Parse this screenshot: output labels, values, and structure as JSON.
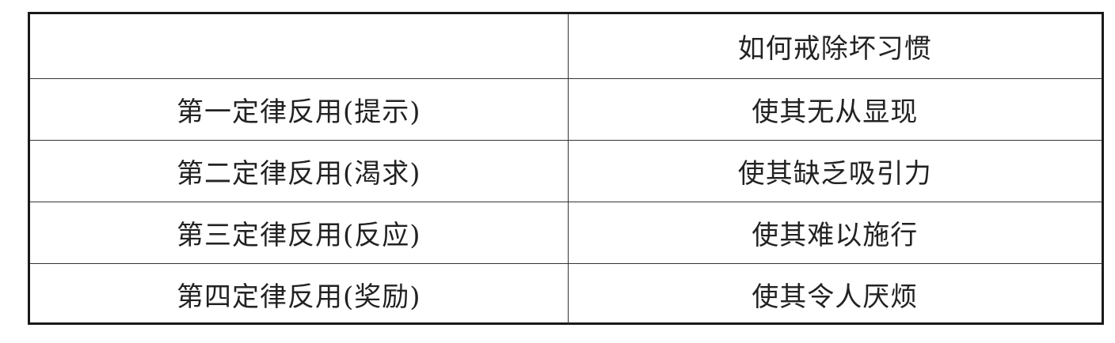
{
  "table": {
    "headers": [
      "",
      "如何戒除坏习惯"
    ],
    "rows": [
      [
        "第一定律反用(提示)",
        "使其无从显现"
      ],
      [
        "第二定律反用(渴求)",
        "使其缺乏吸引力"
      ],
      [
        "第三定律反用(反应)",
        "使其难以施行"
      ],
      [
        "第四定律反用(奖励)",
        "使其令人厌烦"
      ]
    ]
  }
}
